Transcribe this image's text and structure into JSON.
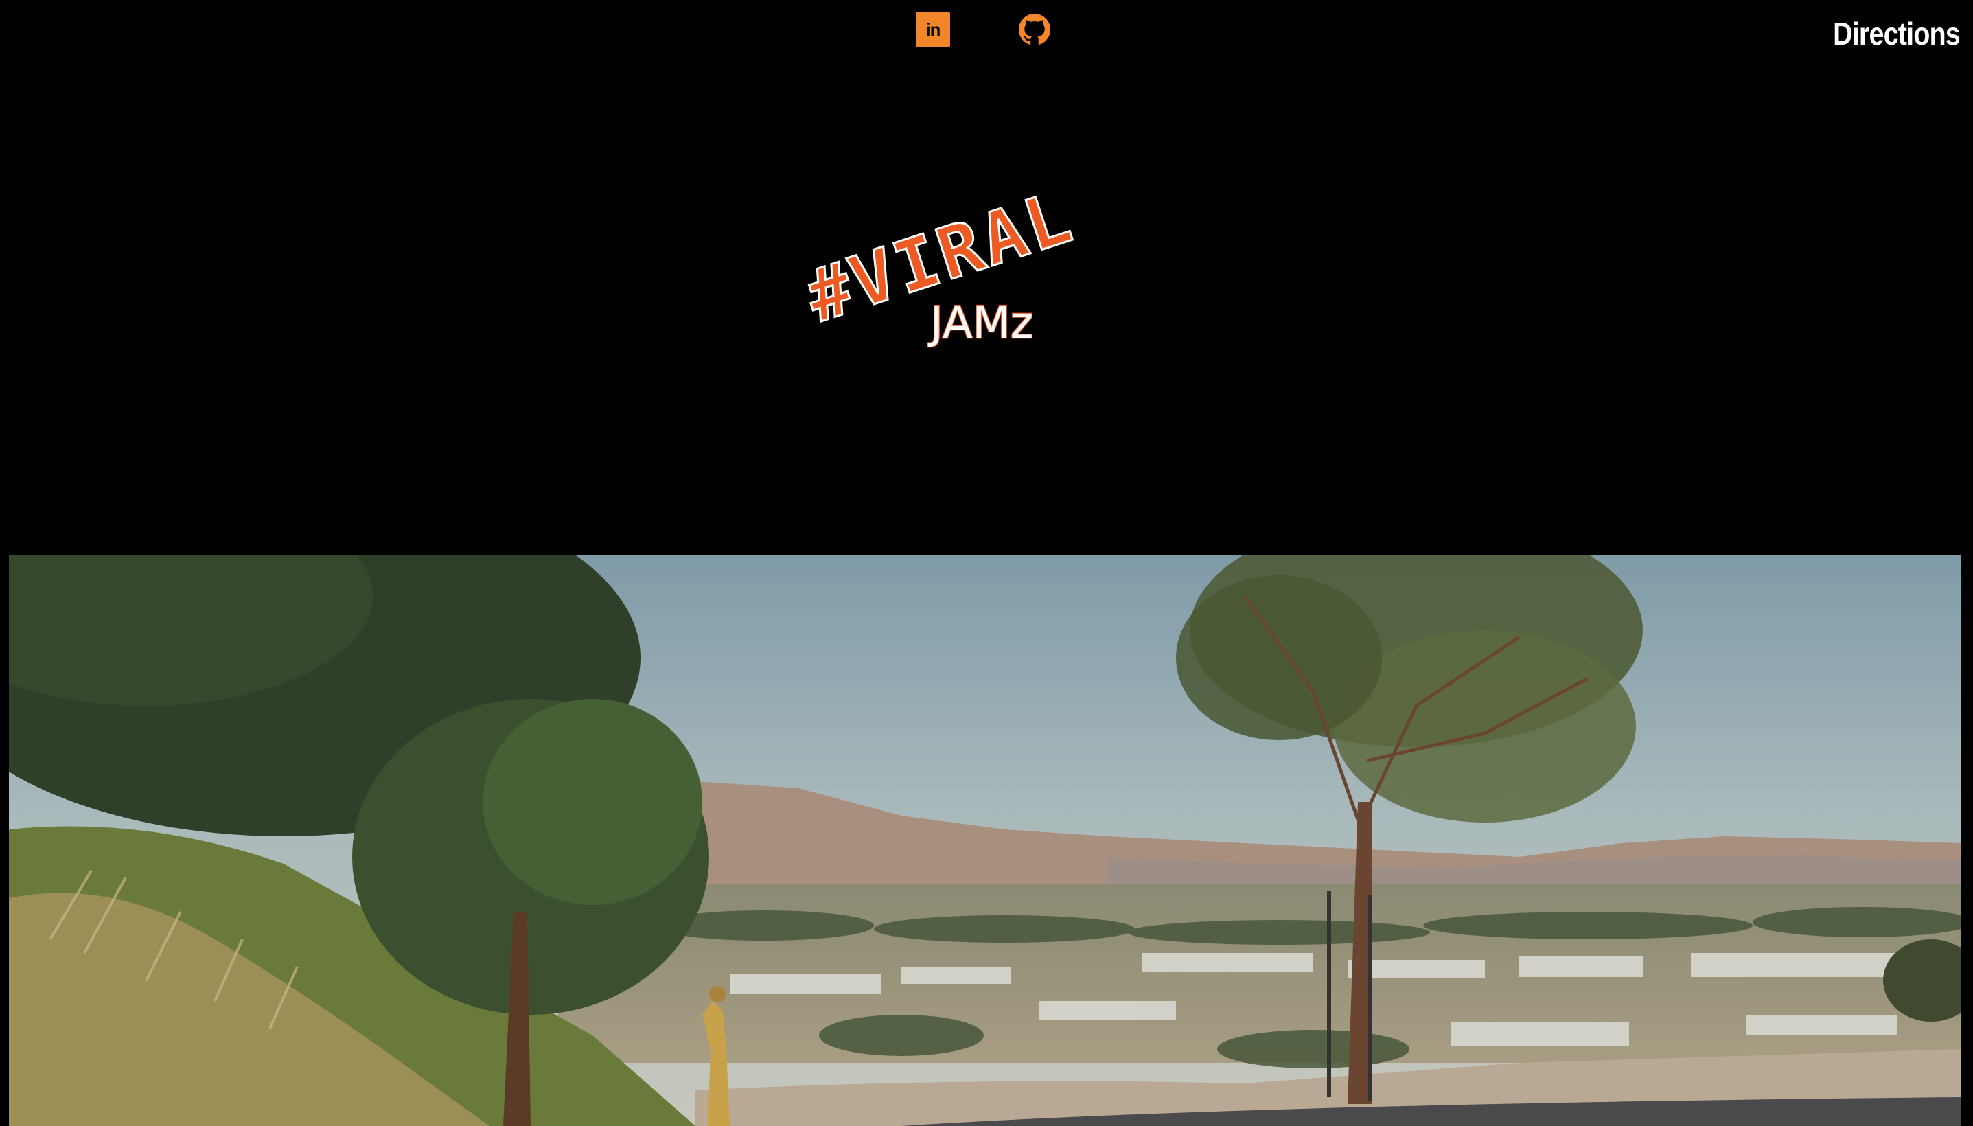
{
  "header": {
    "social": [
      {
        "name": "linkedin",
        "label": "in",
        "icon": "linkedin-icon"
      },
      {
        "name": "github",
        "icon": "github-icon"
      }
    ],
    "nav_link": "Directions"
  },
  "logo": {
    "line1": "#VIRAL",
    "line2": "JAMz"
  },
  "colors": {
    "background": "#000000",
    "accent": "#f2862a",
    "logo_orange": "#ee5a24",
    "text": "#ffffff"
  },
  "hero": {
    "description_icon": "landscape-photo"
  }
}
